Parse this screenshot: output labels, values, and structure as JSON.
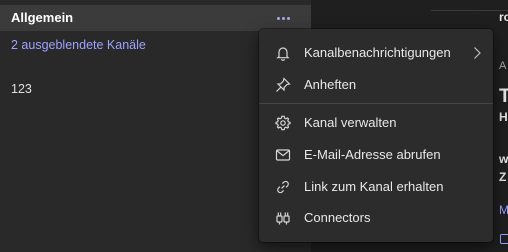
{
  "channel_list": {
    "channel_name": "Allgemein",
    "more_options_icon": "more-horizontal-icon",
    "hidden_channels_link": "2 ausgeblendete Kanäle",
    "channel_123": "123"
  },
  "context_menu": {
    "items": [
      {
        "label": "Kanalbenachrichtigungen",
        "icon": "bell-icon",
        "has_submenu": true
      },
      {
        "label": "Anheften",
        "icon": "pin-icon"
      },
      {
        "label": "Kanal verwalten",
        "icon": "gear-icon"
      },
      {
        "label": "E-Mail-Adresse abrufen",
        "icon": "mail-icon"
      },
      {
        "label": "Link zum Kanal erhalten",
        "icon": "link-icon"
      },
      {
        "label": "Connectors",
        "icon": "connector-icon"
      }
    ]
  },
  "background_pane": {
    "fragment_1": "ro",
    "fragment_2": "A",
    "fragment_3": "T",
    "fragment_4": "H",
    "fragment_5": "w",
    "fragment_6": "Z",
    "fragment_7": "M"
  },
  "colors": {
    "accent": "#9ea2ff",
    "menu_bg": "#2d2c2c",
    "pane_bg": "#292929",
    "selected_row_bg": "#3b3b3b"
  }
}
